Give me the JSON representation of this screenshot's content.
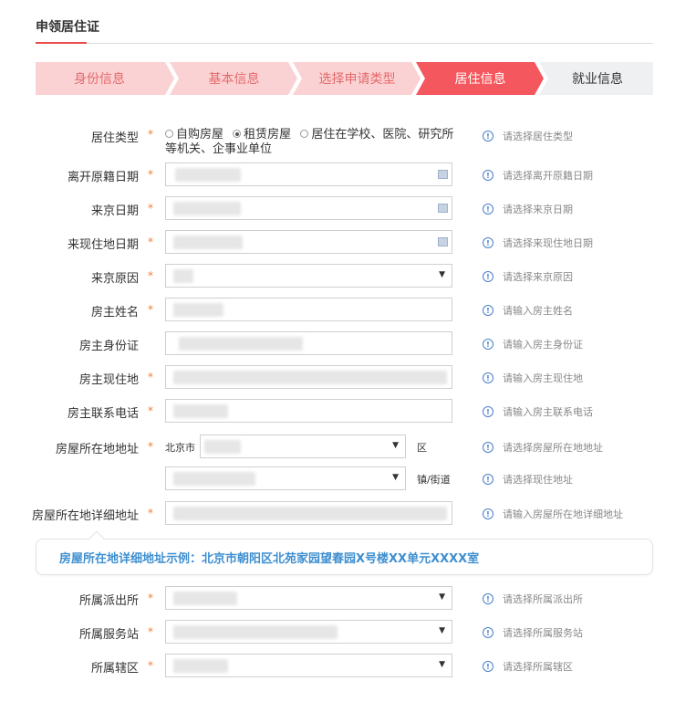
{
  "page": {
    "title": "申领居住证"
  },
  "steps": [
    {
      "label": "身份信息",
      "state": "done"
    },
    {
      "label": "基本信息",
      "state": "done"
    },
    {
      "label": "选择申请类型",
      "state": "done"
    },
    {
      "label": "居住信息",
      "state": "active"
    },
    {
      "label": "就业信息",
      "state": "todo"
    }
  ],
  "colors": {
    "accent": "#f4575d",
    "done_step": "#fbd2d3",
    "todo_step": "#eef0f2",
    "hint_icon": "#4a7fc9",
    "required": "#f0803c",
    "example_text": "#3f8fd0"
  },
  "required_mark": "*",
  "form": {
    "residence_type": {
      "label": "居住类型",
      "options": [
        "自购房屋",
        "租赁房屋",
        "居住在学校、医院、研究所等机关、企事业单位"
      ],
      "selected": "租赁房屋",
      "hint": "请选择居住类型"
    },
    "leave_date": {
      "label": "离开原籍日期",
      "value": "",
      "hint": "请选择离开原籍日期"
    },
    "arrive_beijing_date": {
      "label": "来京日期",
      "value": "",
      "hint": "请选择来京日期"
    },
    "arrive_current_date": {
      "label": "来现住地日期",
      "value": "",
      "hint": "请选择来现住地日期"
    },
    "reason": {
      "label": "来京原因",
      "value": "",
      "hint": "请选择来京原因"
    },
    "landlord_name": {
      "label": "房主姓名",
      "value": "",
      "hint": "请输入房主姓名"
    },
    "landlord_id": {
      "label": "房主身份证",
      "value": "",
      "hint": "请输入房主身份证"
    },
    "landlord_address": {
      "label": "房主现住地",
      "value": "",
      "hint": "请输入房主现住地"
    },
    "landlord_phone": {
      "label": "房主联系电话",
      "value": "",
      "hint": "请输入房主联系电话"
    },
    "house_address": {
      "label": "房屋所在地地址",
      "city": "北京市",
      "district_suffix": "区",
      "street_suffix": "镇/街道",
      "hint": "请选择房屋所在地地址",
      "hint2": "请选择现住地址"
    },
    "house_detail": {
      "label": "房屋所在地详细地址",
      "value": "",
      "hint": "请输入房屋所在地详细地址"
    },
    "example": "房屋所在地详细地址示例：北京市朝阳区北苑家园望春园X号楼XX单元XXXX室",
    "police_station": {
      "label": "所属派出所",
      "value": "",
      "hint": "请选择所属派出所"
    },
    "service_station": {
      "label": "所属服务站",
      "value": "",
      "hint": "请选择所属服务站"
    },
    "jurisdiction": {
      "label": "所属辖区",
      "value": "",
      "hint": "请选择所属辖区"
    }
  },
  "icons": {
    "hint": "info-circle-icon",
    "calendar": "calendar-icon",
    "dropdown": "chevron-down-icon"
  }
}
